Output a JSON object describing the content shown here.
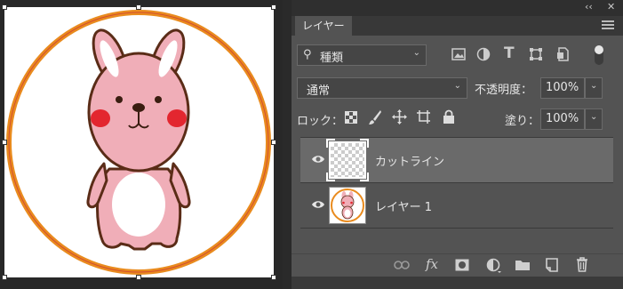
{
  "window": {
    "collapse_label": "‹‹",
    "close_label": "✕"
  },
  "panel": {
    "tab_label": "レイヤー",
    "filter": {
      "search_glyph": "⚲",
      "kind_label": "種類"
    },
    "blend": {
      "mode_label": "通常",
      "opacity_label": "不透明度：",
      "opacity_value": "100%"
    },
    "lock": {
      "label": "ロック：",
      "fill_label": "塗り：",
      "fill_value": "100%"
    },
    "layers": [
      {
        "name": "カットライン",
        "visible": true,
        "selected": true
      },
      {
        "name": "レイヤー 1",
        "visible": true,
        "selected": false
      }
    ],
    "bottom": {
      "fx_label": "fx"
    }
  },
  "colors": {
    "accent_orange": "#e98b1e",
    "rabbit_pink": "#f0aeb8",
    "cheek_red": "#e3262f"
  }
}
